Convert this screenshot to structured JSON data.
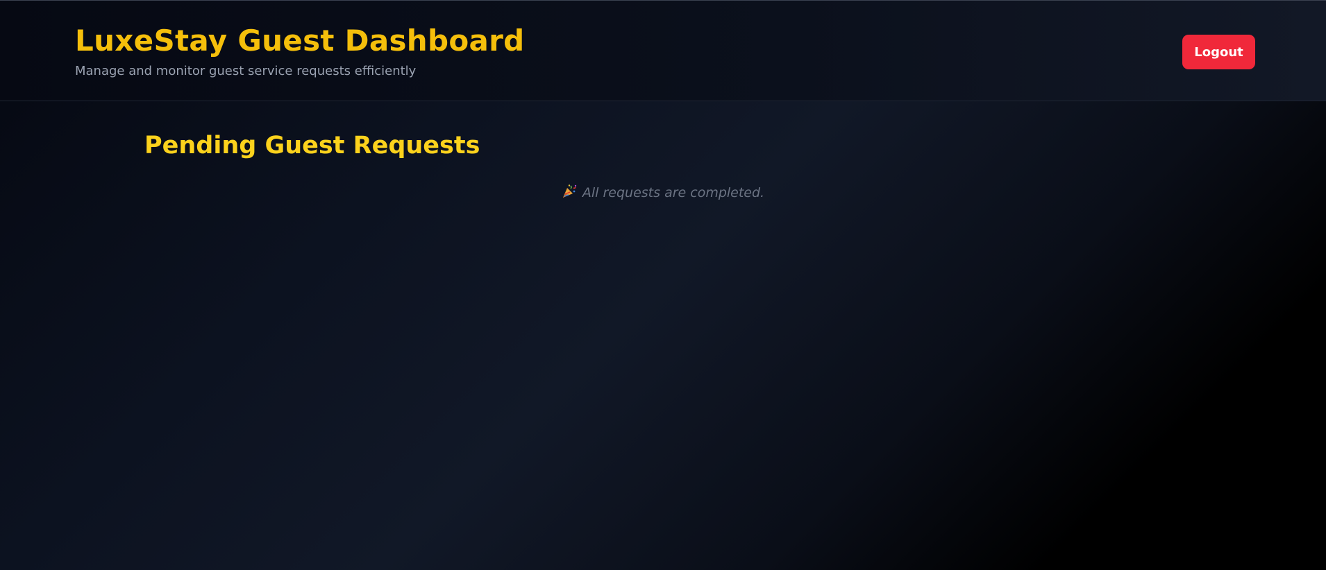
{
  "header": {
    "title": "LuxeStay Guest Dashboard",
    "subtitle": "Manage and monitor guest service requests efficiently",
    "logout_label": "Logout"
  },
  "main": {
    "section_title": "Pending Guest Requests",
    "empty_message": "All requests are completed.",
    "empty_icon": "party-popper-icon"
  },
  "colors": {
    "accent_title": "#f5bf0b",
    "section_title": "#fcd21c",
    "logout_button": "#f0283a",
    "background": "#0c1220"
  }
}
